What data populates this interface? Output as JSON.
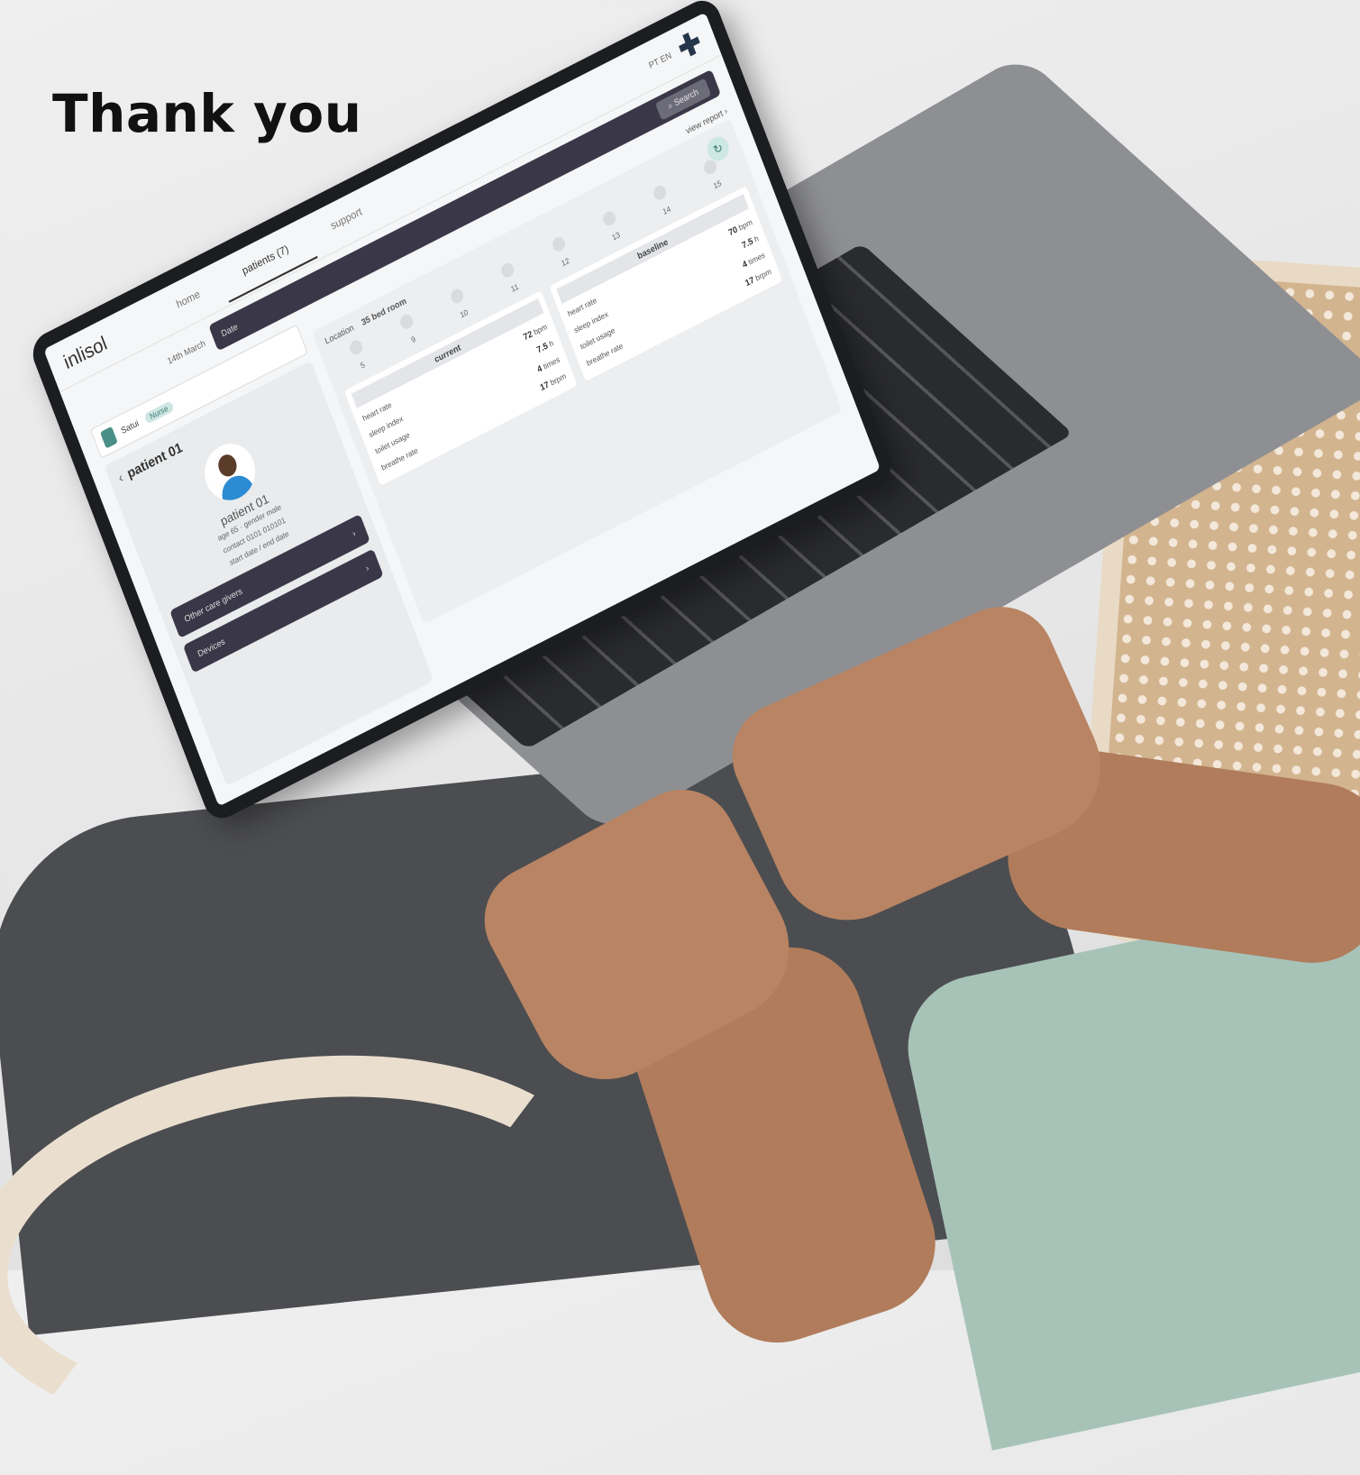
{
  "headline": "Thank you",
  "screen": {
    "logo": "inlisol",
    "nav": [
      "home",
      "patients (7)",
      "support"
    ],
    "lang": "PT EN",
    "date_label": "14th March",
    "filter_date": "Date",
    "search": "Search",
    "view_report": "view report",
    "user": {
      "name": "Satui",
      "role": "Nurse"
    },
    "patient_title": "patient 01",
    "patient": {
      "name": "patient 01",
      "age_gender": "age 65 · gender male",
      "contact": "contact 0101 010101",
      "dates": "start date / end date"
    },
    "buttons": {
      "other_care": "Other care givers",
      "devices": "Devices"
    },
    "location": {
      "label": "Location",
      "value": "35 bed room"
    },
    "calendar": [
      "5",
      "9",
      "10",
      "11",
      "12",
      "13",
      "14",
      "15"
    ],
    "stats_left": {
      "title": "current",
      "rows": [
        {
          "label": "heart rate",
          "value": "72",
          "unit": "bpm"
        },
        {
          "label": "sleep index",
          "value": "7.5",
          "unit": "h"
        },
        {
          "label": "toilet usage",
          "value": "4",
          "unit": "times"
        },
        {
          "label": "breathe rate",
          "value": "17",
          "unit": "brpm"
        }
      ]
    },
    "stats_right": {
      "title": "baseline",
      "rows": [
        {
          "label": "heart rate",
          "value": "70",
          "unit": "bpm"
        },
        {
          "label": "sleep index",
          "value": "7.5",
          "unit": "h"
        },
        {
          "label": "toilet usage",
          "value": "4",
          "unit": "times"
        },
        {
          "label": "breathe rate",
          "value": "17",
          "unit": "brpm"
        }
      ]
    }
  }
}
